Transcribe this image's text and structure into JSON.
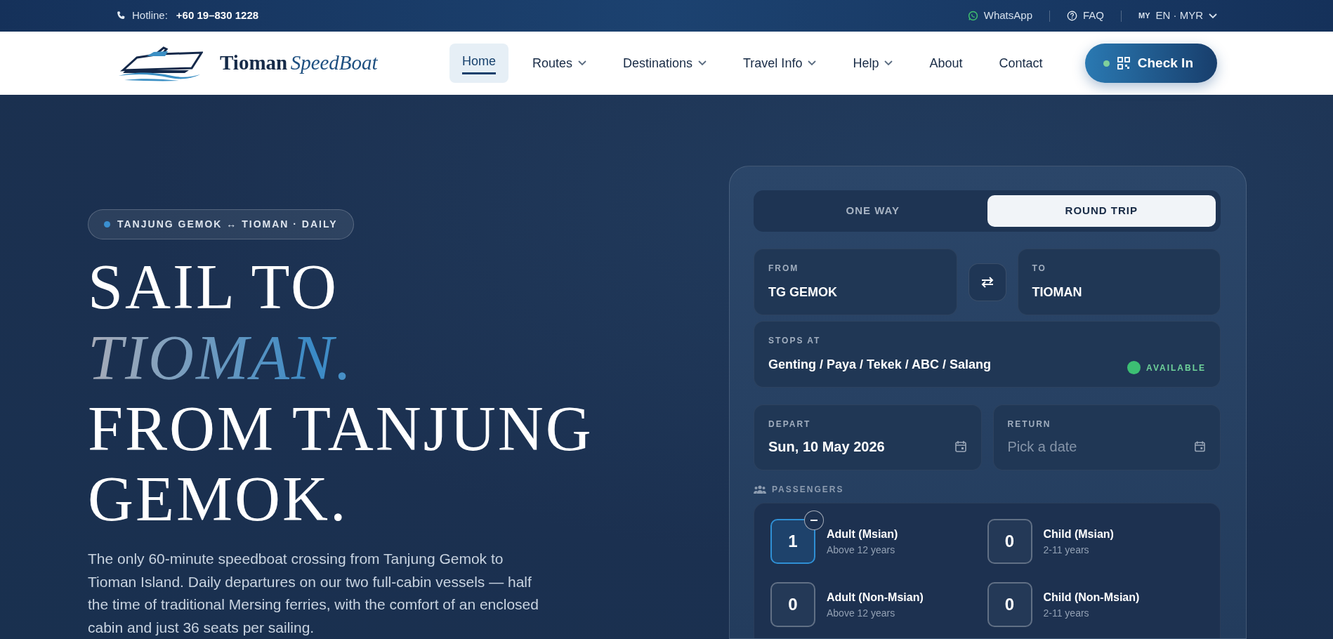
{
  "topbar": {
    "hotline_label": "Hotline:",
    "hotline_number": "+60 19–830 1228",
    "links": [
      {
        "label": "WhatsApp",
        "kind": "whatsapp"
      },
      {
        "label": "FAQ",
        "kind": "faq"
      }
    ],
    "locale": {
      "flag": "MY",
      "label": "EN · MYR"
    }
  },
  "navbar": {
    "brand": {
      "name": "Tioman",
      "name_italic": "SpeedBoat"
    },
    "items": [
      {
        "label": "Home",
        "selected": true,
        "dropdown": false
      },
      {
        "label": "Routes",
        "selected": false,
        "dropdown": true
      },
      {
        "label": "Destinations",
        "selected": false,
        "dropdown": true
      },
      {
        "label": "Travel Info",
        "selected": false,
        "dropdown": true
      },
      {
        "label": "Help",
        "selected": false,
        "dropdown": true
      },
      {
        "label": "About",
        "selected": false,
        "dropdown": false
      },
      {
        "label": "Contact",
        "selected": false,
        "dropdown": false
      }
    ],
    "checkin": "Check In"
  },
  "hero": {
    "badge": "TANJUNG GEMOK ↔ TIOMAN · DAILY",
    "heading": [
      {
        "text": "SAIL TO",
        "kind": "plain"
      },
      {
        "text": "TIOMAN.",
        "kind": "accent"
      },
      {
        "text": "FROM TANJUNG",
        "kind": "plain"
      },
      {
        "text": "GEMOK.",
        "kind": "plain"
      }
    ],
    "description": "The only 60-minute speedboat crossing from Tanjung Gemok to Tioman Island. Daily departures on our two full-cabin vessels — half the time of traditional Mersing ferries, with the comfort of an enclosed cabin and just 36 seats per sailing."
  },
  "booking": {
    "trip_types": [
      {
        "label": "ONE WAY",
        "selected": false
      },
      {
        "label": "ROUND TRIP",
        "selected": true
      }
    ],
    "from": {
      "label": "FROM",
      "value": "TG GEMOK"
    },
    "to": {
      "label": "TO",
      "value": "TIOMAN"
    },
    "stops": {
      "label": "STOPS AT",
      "value": "Genting / Paya / Tekek / ABC / Salang",
      "status": "AVAILABLE"
    },
    "depart": {
      "label": "DEPART",
      "value": "Sun, 10 May 2026"
    },
    "return": {
      "label": "RETURN",
      "placeholder": "Pick a date"
    },
    "passengers": {
      "label": "PASSENGERS",
      "items": [
        {
          "name": "Adult (Msian)",
          "note": "Above 12 years",
          "count": "1",
          "selected": true
        },
        {
          "name": "Child (Msian)",
          "note": "2-11 years",
          "count": "0",
          "selected": false
        },
        {
          "name": "Adult (Non-Msian)",
          "note": "Above 12 years",
          "count": "0",
          "selected": false
        },
        {
          "name": "Child (Non-Msian)",
          "note": "2-11 years",
          "count": "0",
          "selected": false
        }
      ]
    }
  }
}
